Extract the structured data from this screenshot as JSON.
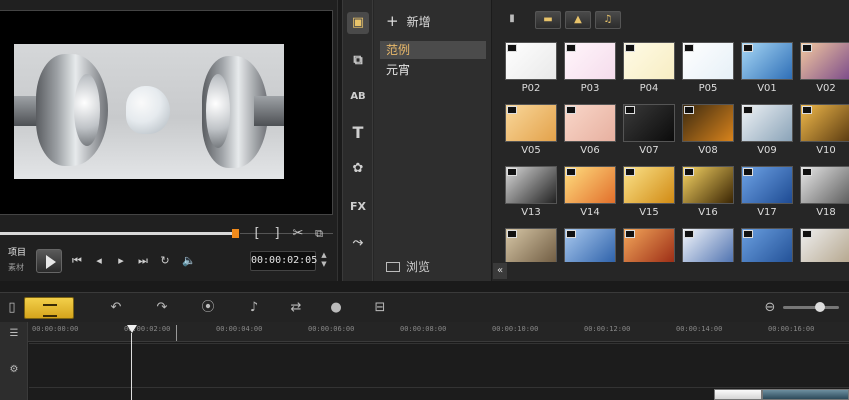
{
  "preview": {
    "mode_label": "项目",
    "mode_sub": "素材",
    "timecode": "00:00:02:05",
    "mark_in": "[",
    "mark_out": "]"
  },
  "library": {
    "add_folder_label": "新增",
    "folders": [
      "范例",
      "元宵"
    ],
    "selected_folder": "范例",
    "browse_label": "浏览",
    "tools": [
      "media-icon",
      "transition-icon",
      "title-icon",
      "text-icon",
      "graphic-icon",
      "fx-icon",
      "path-icon"
    ],
    "thumbnails": [
      {
        "name": "P02"
      },
      {
        "name": "P03"
      },
      {
        "name": "P04"
      },
      {
        "name": "P05"
      },
      {
        "name": "V01"
      },
      {
        "name": "V02"
      },
      {
        "name": "V05"
      },
      {
        "name": "V06"
      },
      {
        "name": "V07"
      },
      {
        "name": "V08"
      },
      {
        "name": "V09"
      },
      {
        "name": "V10"
      },
      {
        "name": "V13"
      },
      {
        "name": "V14"
      },
      {
        "name": "V15"
      },
      {
        "name": "V16"
      },
      {
        "name": "V17"
      },
      {
        "name": "V18"
      },
      {
        "name": ""
      },
      {
        "name": ""
      },
      {
        "name": ""
      },
      {
        "name": ""
      },
      {
        "name": ""
      },
      {
        "name": ""
      }
    ]
  },
  "timeline": {
    "ticks": [
      "00:00:00:00",
      "00:00:02:00",
      "00:00:04:00",
      "00:00:06:00",
      "00:00:08:00",
      "00:00:10:00",
      "00:00:12:00",
      "00:00:14:00",
      "00:00:16:00"
    ]
  },
  "colors": {
    "accent": "#f08a1c",
    "selected_folder_text": "#e8b86a",
    "timeline_view_active": "#f3cf4a"
  }
}
